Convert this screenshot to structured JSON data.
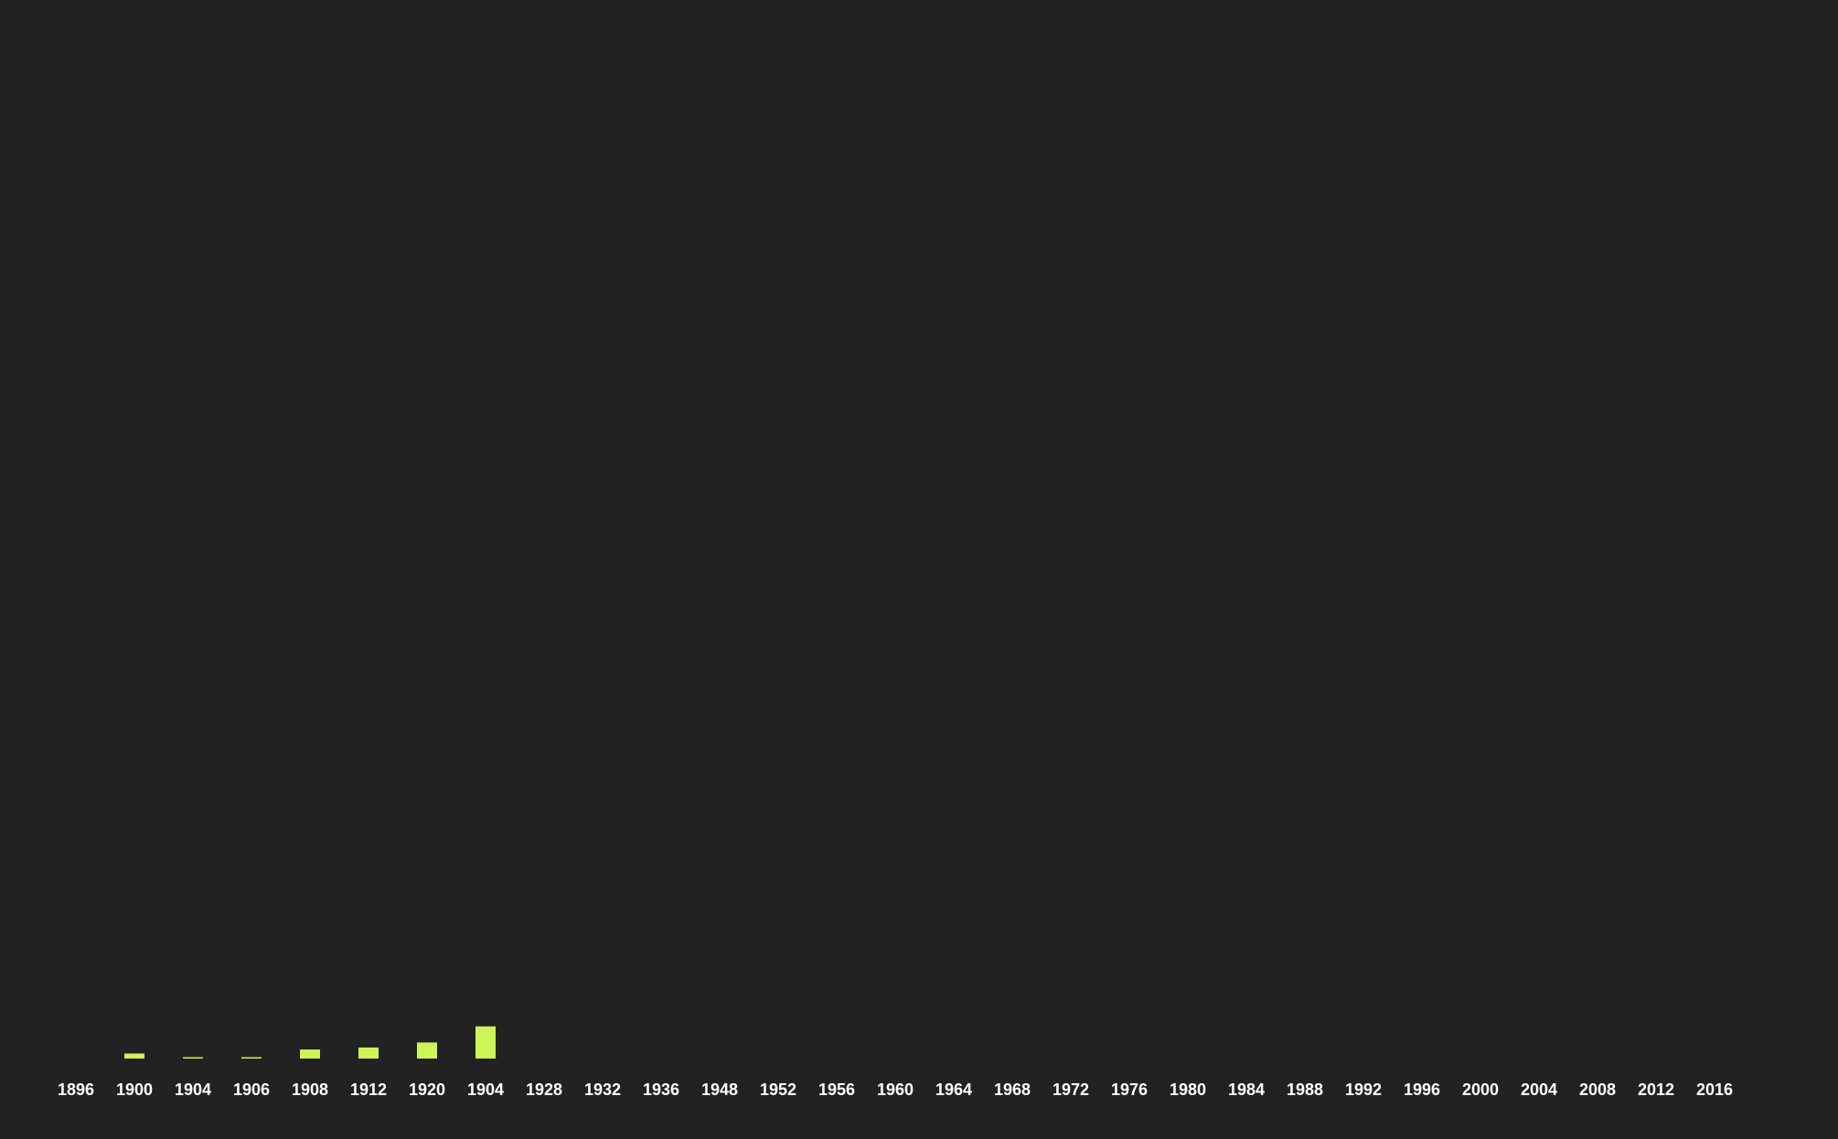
{
  "colors": {
    "background": "#222222",
    "bar": "#cdf55a",
    "label": "#ffffff"
  },
  "chart_data": {
    "type": "bar",
    "title": "",
    "xlabel": "",
    "ylabel": "",
    "grid": false,
    "legend": "none",
    "y_axis_visible": false,
    "categories": [
      "1896",
      "1900",
      "1904",
      "1906",
      "1908",
      "1912",
      "1920",
      "1904",
      "1928",
      "1932",
      "1936",
      "1948",
      "1952",
      "1956",
      "1960",
      "1964",
      "1968",
      "1972",
      "1976",
      "1980",
      "1984",
      "1988",
      "1992",
      "1996",
      "2000",
      "2004",
      "2008",
      "2012",
      "2016"
    ],
    "values": [
      0,
      5,
      1,
      1,
      9,
      11,
      16,
      32,
      null,
      null,
      null,
      null,
      null,
      null,
      null,
      null,
      null,
      null,
      null,
      null,
      null,
      null,
      null,
      null,
      null,
      null,
      null,
      null,
      null
    ],
    "ylim": [
      0,
      1000
    ]
  }
}
